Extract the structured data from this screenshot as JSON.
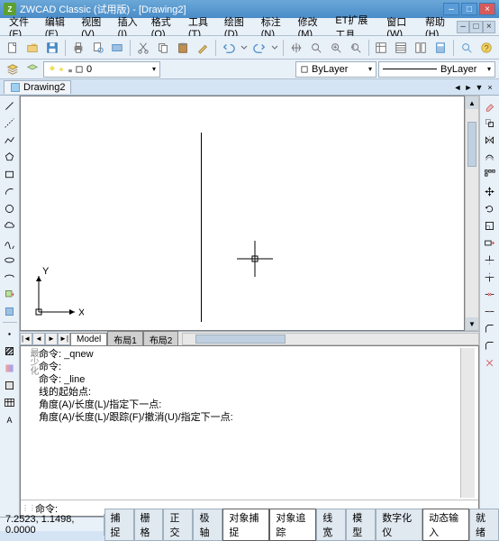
{
  "app": {
    "icon_text": "Z",
    "title": "ZWCAD Classic (试用版) - [Drawing2]"
  },
  "winbuttons": {
    "min": "–",
    "max": "□",
    "close": "×"
  },
  "menu": [
    "文件(F)",
    "编辑(E)",
    "视图(V)",
    "插入(I)",
    "格式(O)",
    "工具(T)",
    "绘图(D)",
    "标注(N)",
    "修改(M)",
    "ET扩展工具",
    "窗口(W)",
    "帮助(H)"
  ],
  "menu_child": {
    "min": "–",
    "max": "□",
    "close": "×"
  },
  "layerbar": {
    "combo1": "0",
    "combo2": "ByLayer",
    "combo3": "ByLayer",
    "dd": "▾"
  },
  "doctab": {
    "name": "Drawing2",
    "nav_prev": "◄",
    "nav_next": "►",
    "close": "×",
    "scroll": "▼"
  },
  "modeltabs": {
    "nav": [
      "|◄",
      "◄",
      "►",
      "►|"
    ],
    "tabs": [
      "Model",
      "布局1",
      "布局2"
    ]
  },
  "ucs": {
    "x": "X",
    "y": "Y"
  },
  "cmd": {
    "side": "最少化",
    "lines": [
      "命令: _qnew",
      "命令:",
      "命令: _line",
      "线的起始点:",
      "角度(A)/长度(L)/指定下一点:",
      "角度(A)/长度(L)/跟踪(F)/撤消(U)/指定下一点:"
    ],
    "prompt": "命令:",
    "value": ""
  },
  "status": {
    "coords": "7.2523, 1.1498, 0.0000",
    "buttons": [
      "捕捉",
      "栅格",
      "正交",
      "极轴",
      "对象捕捉",
      "对象追踪",
      "线宽",
      "模型",
      "数字化仪",
      "动态输入",
      "就绪"
    ],
    "active": [
      4,
      5,
      9
    ]
  },
  "scroll": {
    "up": "▲",
    "down": "▼",
    "left": "◄",
    "right": "►"
  },
  "colors": {
    "accent": "#4a8cc8"
  }
}
